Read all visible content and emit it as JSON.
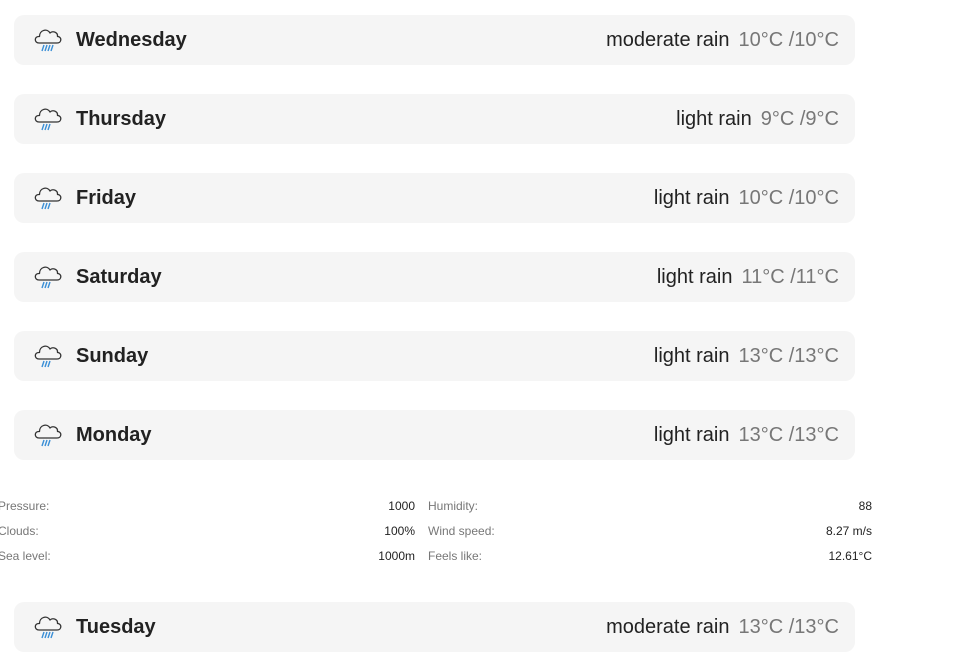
{
  "forecast": [
    {
      "day": "Wednesday",
      "description": "moderate rain",
      "temp": "10°C /10°C",
      "icon": "rain-cloud-icon"
    },
    {
      "day": "Thursday",
      "description": "light rain",
      "temp": "9°C /9°C",
      "icon": "rain-cloud-icon"
    },
    {
      "day": "Friday",
      "description": "light rain",
      "temp": "10°C /10°C",
      "icon": "rain-cloud-icon"
    },
    {
      "day": "Saturday",
      "description": "light rain",
      "temp": "11°C /11°C",
      "icon": "rain-cloud-icon"
    },
    {
      "day": "Sunday",
      "description": "light rain",
      "temp": "13°C /13°C",
      "icon": "rain-cloud-icon"
    },
    {
      "day": "Monday",
      "description": "light rain",
      "temp": "13°C /13°C",
      "icon": "rain-cloud-icon"
    }
  ],
  "details": {
    "pressure_label": "Pressure:",
    "pressure_value": "1000",
    "clouds_label": "Clouds:",
    "clouds_value": "100%",
    "sea_level_label": "Sea level:",
    "sea_level_value": "1000m",
    "humidity_label": "Humidity:",
    "humidity_value": "88",
    "wind_speed_label": "Wind speed:",
    "wind_speed_value": "8.27 m/s",
    "feels_like_label": "Feels like:",
    "feels_like_value": "12.61°C"
  },
  "last_day": {
    "day": "Tuesday",
    "description": "moderate rain",
    "temp": "13°C /13°C",
    "icon": "rain-cloud-icon"
  },
  "colors": {
    "row_background": "#f5f5f5",
    "temp_text": "#777777",
    "rain_drops": "#3a8fd6"
  }
}
